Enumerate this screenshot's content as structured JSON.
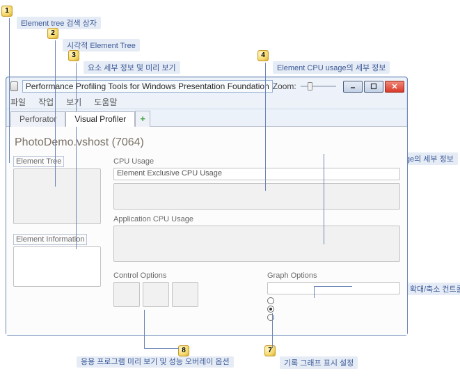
{
  "window": {
    "title": "Performance Profiling Tools for Windows Presentation Foundation",
    "zoom_label": "Zoom:"
  },
  "menu": {
    "m0": "파일",
    "m1": "작업",
    "m2": "보기",
    "m3": "도움말"
  },
  "tabs": {
    "t0": "Perforator",
    "t1": "Visual Profiler"
  },
  "process_title": "PhotoDemo.vshost (7064)",
  "left": {
    "tree_label": "Element Tree",
    "info_label": "Element Information"
  },
  "right": {
    "cpu_label": "CPU Usage",
    "elem_excl_label": "Element Exclusive CPU Usage",
    "app_cpu_label": "Application CPU Usage",
    "control_opts_label": "Control Options",
    "graph_opts_label": "Graph Options"
  },
  "callouts": {
    "c1": "Element tree 검색 상자",
    "c2": "시각적 Element Tree",
    "c3": "요소 세부 정보 및 미리 보기",
    "c4": "Element CPU usage의 세부 정보",
    "c5": "Application CPU usage의 세부 정보",
    "c6": "캡처된 데이터 확대/축소 컨트롤",
    "c7": "기록 그래프 표시 설정",
    "c8": "응용 프로그램 미리 보기 및 성능 오버레이 옵션"
  }
}
